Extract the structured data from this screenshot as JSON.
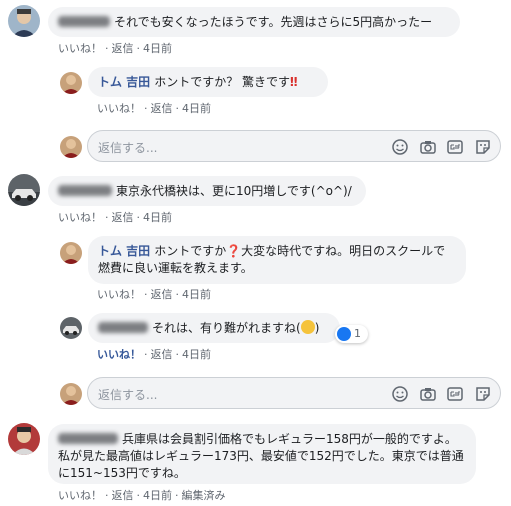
{
  "colors": {
    "link": "#385898",
    "bubble": "#f2f3f5",
    "meta": "#606770"
  },
  "comments": [
    {
      "author": "",
      "text": "それでも安くなったほうです。先週はさらに5円高かったー",
      "actions": {
        "like": "いいね！",
        "reply": "返信",
        "time": "4日前"
      }
    },
    {
      "author": "",
      "text": "東京永代橋袂は、更に10円増しです(^o^)/",
      "actions": {
        "like": "いいね！",
        "reply": "返信",
        "time": "4日前"
      }
    },
    {
      "author": "",
      "text": "兵庫県は会員割引価格でもレギュラー158円が一般的ですよ。私が見た最高値はレギュラー173円、最安値で152円でした。東京では普通に151~153円ですね。",
      "actions": {
        "like": "いいね！",
        "reply": "返信",
        "time": "4日前",
        "edited": "編集済み"
      }
    }
  ],
  "replies": [
    {
      "author": "トム 吉田",
      "text": "ホントですか？ 驚きです",
      "emoji": "‼",
      "actions": {
        "like": "いいね！",
        "reply": "返信",
        "time": "4日前"
      }
    },
    {
      "author": "トム 吉田",
      "text_pre": "ホントですか",
      "emoji": "❓",
      "text_post": "大変な時代ですね。明日のスクールで燃費に良い運転を教えます。",
      "actions": {
        "like": "いいね！",
        "reply": "返信",
        "time": "4日前"
      }
    },
    {
      "author": "",
      "text": "それは、有り難がれますね(",
      "text_end": ")",
      "reaction_count": "1",
      "actions": {
        "like": "いいね！",
        "reply": "返信",
        "time": "4日前"
      }
    }
  ],
  "reply_box": {
    "placeholder": "返信する..."
  },
  "icons": [
    "emoji-icon",
    "camera-icon",
    "gif-icon",
    "sticker-icon"
  ]
}
